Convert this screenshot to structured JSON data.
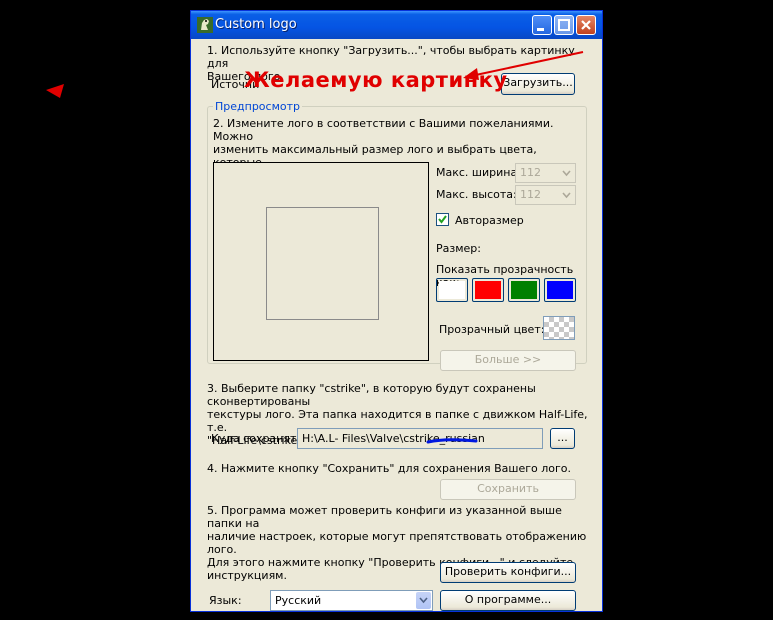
{
  "window": {
    "title": "Custom logo"
  },
  "step1": {
    "text": "1. Используйте кнопку \"Загрузить...\", чтобы выбрать картинку для\nВашего лого.",
    "source_label": "Источни",
    "load_button": "Загрузить..."
  },
  "annotation": {
    "text": "Желаемую картинку",
    "color": "#e00000"
  },
  "preview": {
    "group_title": "Предпросмотр",
    "step2_text": "2. Измените лого в соответствии с Вашими пожеланиями. Можно\nизменить максимальный размер лого и выбрать цвета, которые\nбудут прозрачными.",
    "max_width_label": "Макс. ширина:",
    "max_width_value": "112",
    "max_height_label": "Макс. высота:",
    "max_height_value": "112",
    "autosize_label": "Авторазмер",
    "autosize_checked": true,
    "size_label": "Размер:",
    "show_transparency_label": "Показать прозрачность как:",
    "transparency_colors": [
      "#ffffff",
      "#ff0000",
      "#008000",
      "#0000ff"
    ],
    "transparent_color_label": "Прозрачный цвет:",
    "more_button": "Больше >>"
  },
  "step3": {
    "text": "3. Выберите папку \"cstrike\", в которую будут сохранены сконвертированы\nтекстуры лого. Эта папка находится в папке с движком Half-Life, т.е.\n\"Half-Life\\cstrike\" или \"CS\\cstrike\".",
    "save_to_label": "Куда сохранять:",
    "save_to_value": "H:\\A.L- Files\\Valve\\cstrike_russian",
    "browse_button": "..."
  },
  "step4": {
    "text": "4. Нажмите кнопку \"Сохранить\" для сохранения Вашего лого.",
    "save_button": "Сохранить"
  },
  "step5": {
    "text": "5. Программа может проверить конфиги из указанной выше папки на\nналичие настроек, которые могут препятствовать отображению лого.\nДля этого нажмите кнопку \"Проверить конфиги...\" и следуйте\nинструкциям.",
    "check_button": "Проверить конфиги..."
  },
  "footer": {
    "language_label": "Язык:",
    "language_value": "Русский",
    "about_button": "О программе..."
  }
}
